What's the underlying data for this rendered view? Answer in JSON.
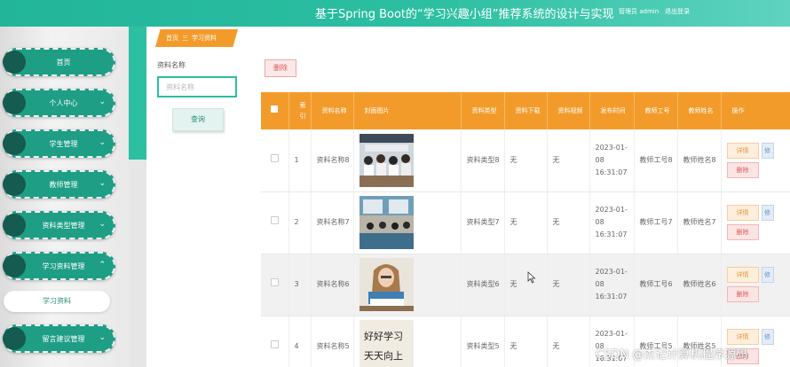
{
  "header": {
    "title": "基于Spring Boot的“学习兴趣小组”推荐系统的设计与实现",
    "user_label": "管理员 admin",
    "logout": "退出登录",
    "accent": "#2cbfa2"
  },
  "sidebar": {
    "items": [
      {
        "label": "首页",
        "icon": "home-icon",
        "has_chevron": false
      },
      {
        "label": "个人中心",
        "icon": "user-icon",
        "has_chevron": true
      },
      {
        "label": "学生管理",
        "icon": "student-icon",
        "has_chevron": true
      },
      {
        "label": "教师管理",
        "icon": "teacher-icon",
        "has_chevron": true
      },
      {
        "label": "资料类型管理",
        "icon": "category-icon",
        "has_chevron": true
      },
      {
        "label": "学习资料管理",
        "icon": "book-icon",
        "has_chevron": true,
        "expanded": true
      },
      {
        "label": "留言建议管理",
        "icon": "message-icon",
        "has_chevron": true
      }
    ],
    "submenu": {
      "label": "学习资料"
    }
  },
  "breadcrumb": {
    "home": "首页",
    "separator": "三",
    "current": "学习资料"
  },
  "search": {
    "label": "资料名称",
    "placeholder": "资料名称",
    "value": "",
    "button": "查询"
  },
  "toolbar": {
    "delete_label": "删除",
    "delete_color": "#e05b5b"
  },
  "table": {
    "header_color": "#f39b2a",
    "headers": [
      "索引",
      "资料名称",
      "封面图片",
      "资料类型",
      "资料下载",
      "资料视频",
      "发布时间",
      "教师工号",
      "教师姓名",
      "操作"
    ],
    "rows": [
      {
        "index": "1",
        "name": "资料名称8",
        "cover": "classroom-photo",
        "type": "资料类型8",
        "download": "无",
        "video": "无",
        "time": "2023-01-08 16:31:07",
        "teacher_no": "教师工号8",
        "teacher_name": "教师姓名8"
      },
      {
        "index": "2",
        "name": "资料名称7",
        "cover": "lecture-hall-photo",
        "type": "资料类型7",
        "download": "无",
        "video": "无",
        "time": "2023-01-08 16:31:07",
        "teacher_no": "教师工号7",
        "teacher_name": "教师姓名7"
      },
      {
        "index": "3",
        "name": "资料名称6",
        "cover": "student-reading-photo",
        "type": "资料类型6",
        "download": "无",
        "video": "无",
        "time": "2023-01-08 16:31:07",
        "teacher_no": "教师工号6",
        "teacher_name": "教师姓名6"
      },
      {
        "index": "4",
        "name": "资料名称5",
        "cover": "calligraphy-photo",
        "type": "资料类型5",
        "download": "无",
        "video": "无",
        "time": "2023-01-08 16:31:07",
        "teacher_no": "教师工号5",
        "teacher_name": "教师姓名5"
      }
    ],
    "actions": {
      "detail": "详情",
      "delete": "删除",
      "more": "修"
    }
  },
  "watermark": "CSDN @杰记计算机程序源码",
  "cover_texts": {
    "calligraphy_line1": "好好学习",
    "calligraphy_line2": "天天向上"
  }
}
